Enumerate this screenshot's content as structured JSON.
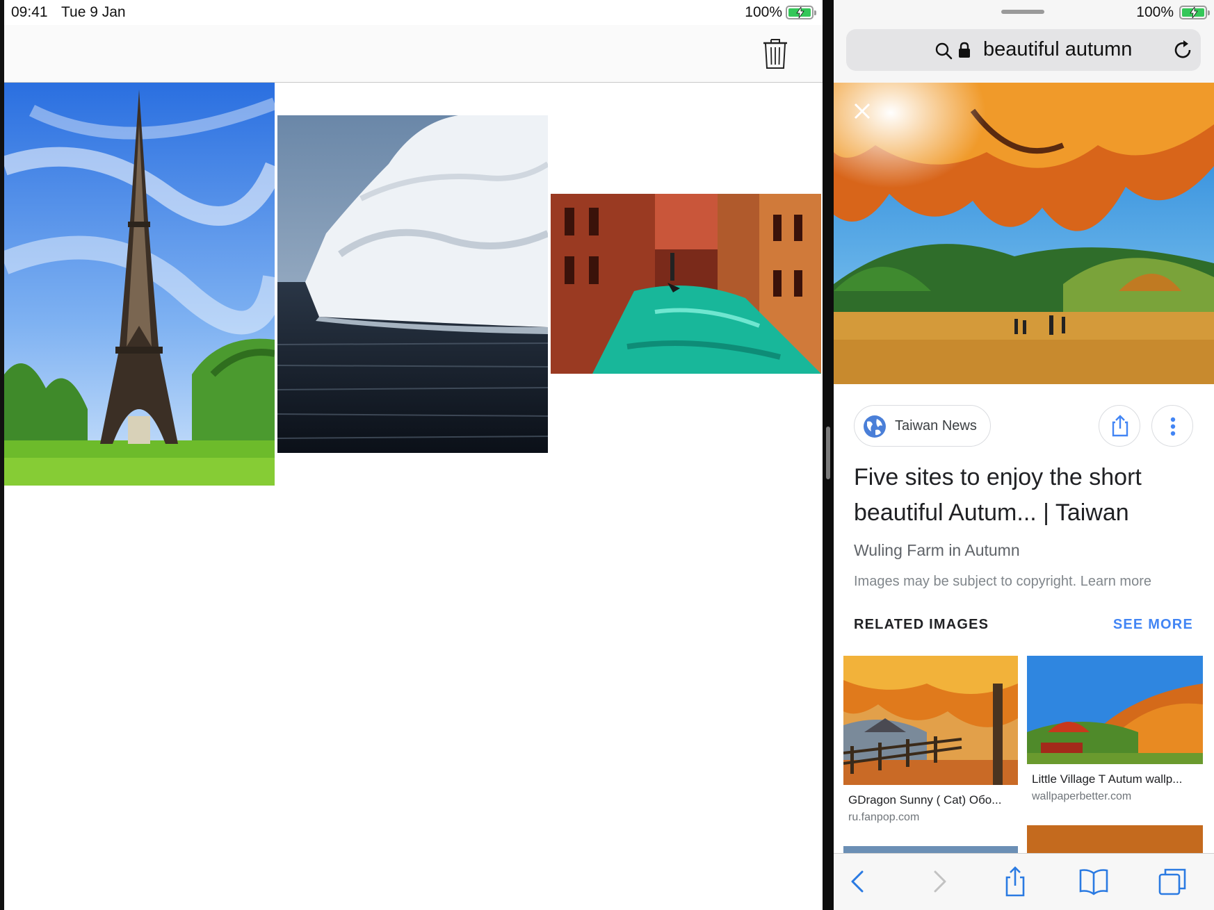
{
  "left_app": {
    "status_bar": {
      "time": "09:41",
      "date": "Tue 9 Jan",
      "battery": "100%"
    },
    "toolbar": {
      "trash_icon": "trash-icon"
    },
    "canvas_photos": [
      {
        "subject": "Eiffel Tower"
      },
      {
        "subject": "Iceberg"
      },
      {
        "subject": "Venice canal"
      }
    ]
  },
  "safari": {
    "status_bar": {
      "battery": "100%"
    },
    "address_bar": {
      "query": "beautiful autumn",
      "search_icon": "search-icon",
      "lock_icon": "lock-icon",
      "reload_icon": "reload-icon"
    },
    "result": {
      "source": "Taiwan News",
      "title": "Five sites to enjoy the short beautiful Autum... | Taiwan",
      "subtitle": "Wuling Farm in Autumn",
      "copyright": "Images may be subject to copyright.",
      "learn_more": "Learn more"
    },
    "related": {
      "heading": "RELATED IMAGES",
      "see_more": "SEE MORE",
      "cards": [
        {
          "caption": "GDragon Sunny ( Cat) Обо...",
          "source": "ru.fanpop.com"
        },
        {
          "caption": "Little Village T Autum wallp...",
          "source": "wallpaperbetter.com"
        }
      ]
    },
    "toolbar": [
      "back-icon",
      "forward-icon",
      "share-icon",
      "bookmarks-icon",
      "tabs-icon"
    ]
  },
  "colors": {
    "accent_blue": "#4285f4",
    "battery_green": "#34c759"
  }
}
